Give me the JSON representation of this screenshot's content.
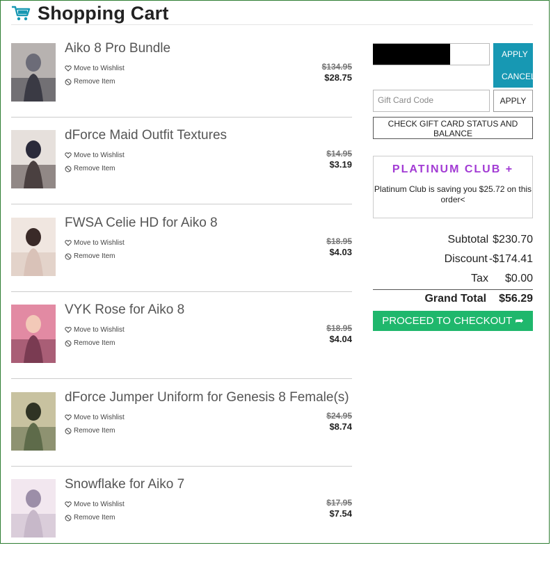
{
  "header": {
    "title": "Shopping Cart",
    "icon": "cart-icon",
    "accent": "#1798b3"
  },
  "items": [
    {
      "title": "Aiko 8 Pro Bundle",
      "wishlist": "Move to Wishlist",
      "remove": "Remove Item",
      "old_price": "$134.95",
      "new_price": "$28.75"
    },
    {
      "title": "dForce Maid Outfit Textures",
      "wishlist": "Move to Wishlist",
      "remove": "Remove Item",
      "old_price": "$14.95",
      "new_price": "$3.19"
    },
    {
      "title": "FWSA Celie HD for Aiko 8",
      "wishlist": "Move to Wishlist",
      "remove": "Remove Item",
      "old_price": "$18.95",
      "new_price": "$4.03"
    },
    {
      "title": "VYK Rose for Aiko 8",
      "wishlist": "Move to Wishlist",
      "remove": "Remove Item",
      "old_price": "$18.95",
      "new_price": "$4.04"
    },
    {
      "title": "dForce Jumper Uniform for Genesis 8 Female(s)",
      "wishlist": "Move to Wishlist",
      "remove": "Remove Item",
      "old_price": "$24.95",
      "new_price": "$8.74"
    },
    {
      "title": "Snowflake for Aiko 7",
      "wishlist": "Move to Wishlist",
      "remove": "Remove Item",
      "old_price": "$17.95",
      "new_price": "$7.54"
    }
  ],
  "coupon": {
    "value": "",
    "apply": "APPLY",
    "cancel": "CANCEL"
  },
  "gift_card": {
    "placeholder": "Gift Card Code",
    "apply": "APPLY",
    "check": "CHECK GIFT CARD STATUS AND BALANCE"
  },
  "platinum": {
    "logo": "PLATINUM CLUB +",
    "saving": "Platinum Club is saving you $25.72 on this order<",
    "color": "#a23bd4"
  },
  "totals": {
    "subtotal_label": "Subtotal",
    "subtotal": "$230.70",
    "discount_label": "Discount",
    "discount": "-$174.41",
    "tax_label": "Tax",
    "tax": "$0.00",
    "grand_label": "Grand Total",
    "grand": "$56.29"
  },
  "checkout": {
    "label": "PROCEED TO CHECKOUT ➦",
    "color": "#1fb76c"
  }
}
